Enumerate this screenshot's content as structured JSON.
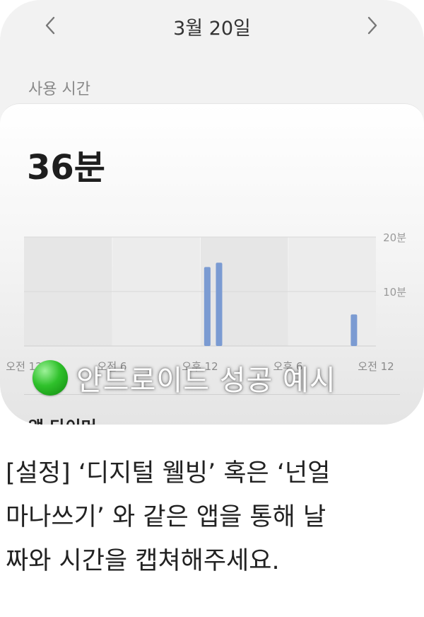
{
  "header": {
    "date": "3월 20일",
    "prev_icon": "chevron-left-icon",
    "next_icon": "chevron-right-icon"
  },
  "usage": {
    "section_label": "사용 시간",
    "total": "36분",
    "next_section_label": "앱 타이머"
  },
  "chart_data": {
    "type": "bar",
    "x_tick_labels": [
      "오전 12",
      "오전 6",
      "오후 12",
      "오후 6",
      "오전 12"
    ],
    "y_tick_labels": [
      "20분",
      "10분"
    ],
    "y_unit": "분",
    "ylim": [
      0,
      20
    ],
    "grid": true,
    "bar_color": "#7b9bd2",
    "x_range_hours": [
      0,
      24
    ],
    "bars": [
      {
        "hour": 12.5,
        "value": 14.5
      },
      {
        "hour": 13.3,
        "value": 15.3
      },
      {
        "hour": 22.5,
        "value": 5.8
      }
    ]
  },
  "overlay": {
    "text": "안드로이드 성공 예시",
    "dot_color": "#2fc12b"
  },
  "instruction": {
    "lines": [
      "[설정] ‘디지털 웰빙’ 혹은 ‘넌얼",
      "마나쓰기’ 와 같은 앱을 통해 날",
      "짜와 시간을 캡쳐해주세요."
    ]
  }
}
